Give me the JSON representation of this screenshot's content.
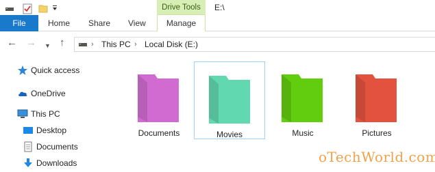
{
  "titlebar": {
    "contextual_group": "Drive Tools",
    "path_title": "E:\\"
  },
  "ribbon": {
    "file_label": "File",
    "tabs": [
      "Home",
      "Share",
      "View"
    ],
    "manage_label": "Manage"
  },
  "address": {
    "crumbs": [
      "This PC",
      "Local Disk (E:)"
    ]
  },
  "navpane": {
    "items": [
      {
        "label": "Quick access",
        "icon": "star-icon"
      },
      {
        "label": "OneDrive",
        "icon": "cloud-icon"
      },
      {
        "label": "This PC",
        "icon": "computer-icon"
      },
      {
        "label": "Desktop",
        "icon": "desktop-icon"
      },
      {
        "label": "Documents",
        "icon": "documents-icon"
      },
      {
        "label": "Downloads",
        "icon": "download-arrow-icon"
      }
    ]
  },
  "folders": [
    {
      "label": "Documents",
      "color": "#d16bd1",
      "selected": false
    },
    {
      "label": "Movies",
      "color": "#62d8b0",
      "selected": true
    },
    {
      "label": "Music",
      "color": "#62cc0e",
      "selected": false
    },
    {
      "label": "Pictures",
      "color": "#e2523f",
      "selected": false
    }
  ],
  "colors": {
    "file_tab": "#1979ca",
    "contextual_tab": "#d7efb6",
    "selection_border": "#99d1ff"
  },
  "watermark": "oTechWorld.com"
}
